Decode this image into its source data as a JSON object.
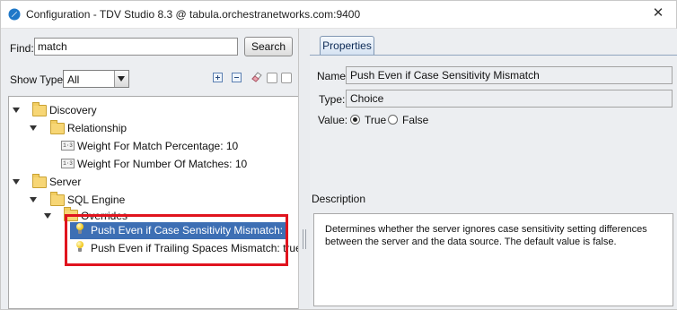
{
  "window": {
    "title": "Configuration - TDV Studio 8.3 @ tabula.orchestranetworks.com:9400",
    "close_icon": "close-icon"
  },
  "search": {
    "find_label": "Find:",
    "value": "match",
    "button_label": "Search"
  },
  "filter": {
    "show_type_label": "Show Type:",
    "selected": "All"
  },
  "toolbar_icons": [
    "expand-all-icon",
    "collapse-all-icon",
    "eraser-icon",
    "toggle-box-icon",
    "toggle-box-icon"
  ],
  "tree": {
    "discovery": "Discovery",
    "relationship": "Relationship",
    "weight_match": "Weight For Match Percentage: 10",
    "weight_number": "Weight For Number Of Matches: 10",
    "server": "Server",
    "sql_engine": "SQL Engine",
    "overrides": "Overrides",
    "push_case": "Push Even if Case Sensitivity Mismatch: true",
    "push_trailing": "Push Even if Trailing Spaces Mismatch: true",
    "number_icon_text": "1·3",
    "selection_color": "#3d6fb4",
    "highlight_color": "#e0141e"
  },
  "properties": {
    "tab_label": "Properties",
    "name_label": "Name:",
    "name_value": "Push Even if Case Sensitivity Mismatch",
    "type_label": "Type:",
    "type_value": "Choice",
    "value_label": "Value:",
    "true_label": "True",
    "false_label": "False",
    "selected_value": "True",
    "description_label": "Description",
    "description_text": "Determines whether the server ignores case sensitivity setting differences between the server and the data source. The default value is false."
  }
}
